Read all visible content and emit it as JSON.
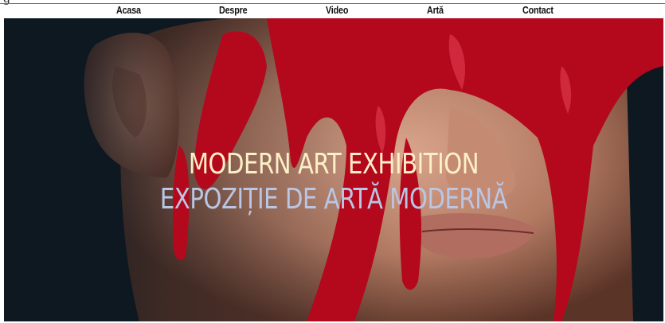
{
  "nav": {
    "items": [
      {
        "label": "Acasa"
      },
      {
        "label": "Despre"
      },
      {
        "label": "Video"
      },
      {
        "label": "Artă"
      },
      {
        "label": "Contact"
      }
    ]
  },
  "hero": {
    "title_en": "MODERN ART EXHIBITION",
    "title_ro": "EXPOZIȚIE DE ARTĂ MODERNĂ"
  },
  "colors": {
    "title_en": "#fdf0c7",
    "title_ro": "#b9c6e4",
    "paint": "#b4081c",
    "background": "#0d1821"
  }
}
